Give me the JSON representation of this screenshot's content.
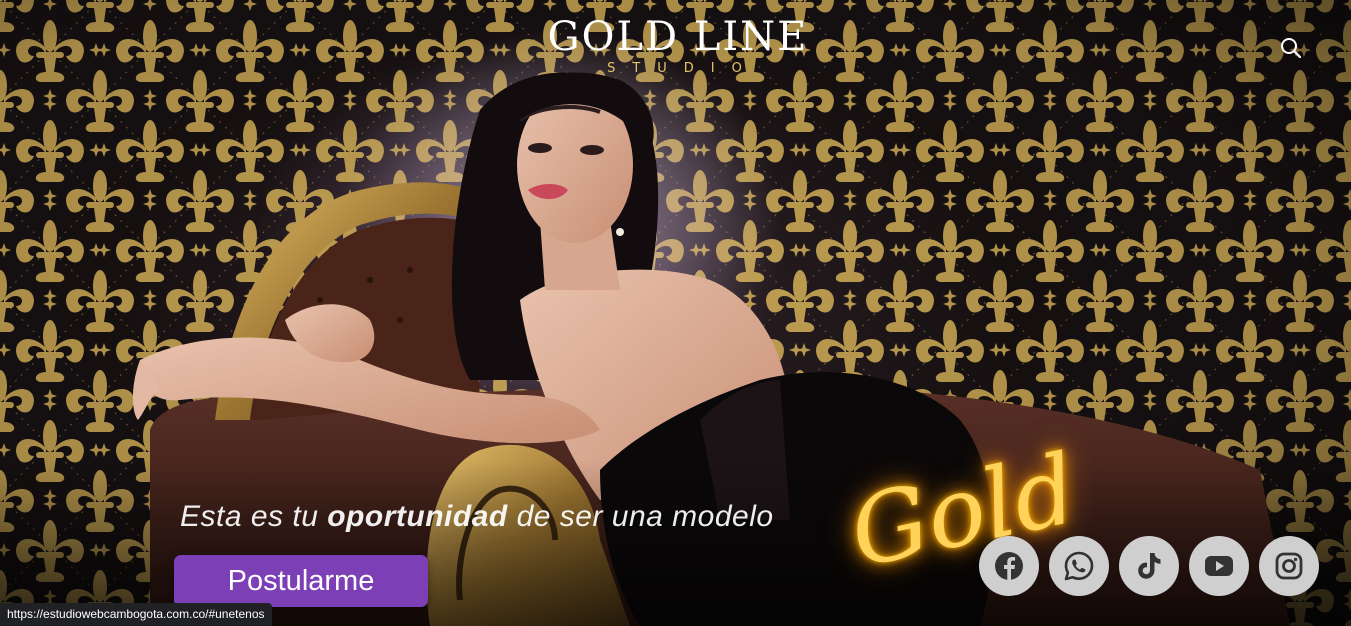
{
  "logo": {
    "title": "GOLD LINE",
    "subtitle": "STUDIO"
  },
  "header": {
    "search_icon": "search-icon"
  },
  "hero": {
    "tagline_start": "Esta es tu",
    "tagline_bold": "oportunidad",
    "tagline_end": "de ser una modelo",
    "neon_text": "Gold",
    "cta_label": "Postularme"
  },
  "social": [
    {
      "name": "facebook",
      "icon": "facebook-icon"
    },
    {
      "name": "whatsapp",
      "icon": "whatsapp-icon"
    },
    {
      "name": "tiktok",
      "icon": "tiktok-icon"
    },
    {
      "name": "youtube",
      "icon": "youtube-icon"
    },
    {
      "name": "instagram",
      "icon": "instagram-icon"
    }
  ],
  "status_bar": {
    "url": "https://estudiowebcambogota.com.co/#unetenos"
  },
  "colors": {
    "gold": "#e5c46a",
    "neon": "#ffd35a",
    "cta": "#7c3fb5",
    "social_bg": "#cfcfcf"
  }
}
